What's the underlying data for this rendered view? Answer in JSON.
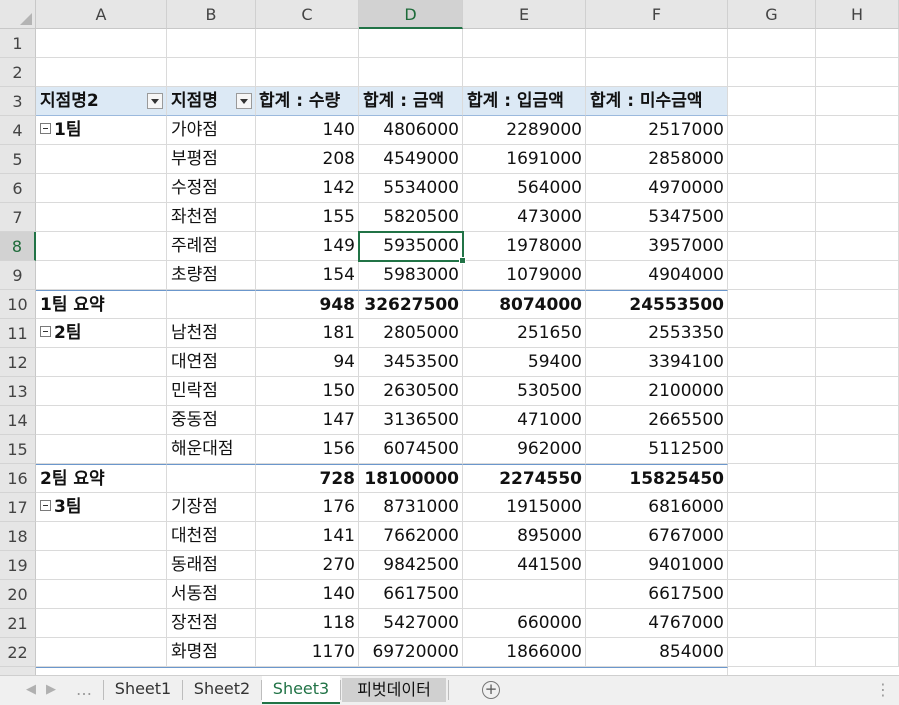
{
  "columns": [
    "A",
    "B",
    "C",
    "D",
    "E",
    "F",
    "G",
    "H"
  ],
  "rows": [
    "1",
    "2",
    "3",
    "4",
    "5",
    "6",
    "7",
    "8",
    "9",
    "10",
    "11",
    "12",
    "13",
    "14",
    "15",
    "16",
    "17",
    "18",
    "19",
    "20",
    "21",
    "22"
  ],
  "headers": {
    "a": "지점명2",
    "b": "지점명",
    "c": "합계 : 수량",
    "d": "합계 : 금액",
    "e": "합계 : 입금액",
    "f": "합계 : 미수금액"
  },
  "groups": {
    "g1": "1팀",
    "g2": "2팀",
    "g3": "3팀"
  },
  "data_rows": [
    {
      "a": "1팀",
      "b": "가야점",
      "c": "140",
      "d": "4806000",
      "e": "2289000",
      "f": "2517000"
    },
    {
      "a": "",
      "b": "부평점",
      "c": "208",
      "d": "4549000",
      "e": "1691000",
      "f": "2858000"
    },
    {
      "a": "",
      "b": "수정점",
      "c": "142",
      "d": "5534000",
      "e": "564000",
      "f": "4970000"
    },
    {
      "a": "",
      "b": "좌천점",
      "c": "155",
      "d": "5820500",
      "e": "473000",
      "f": "5347500"
    },
    {
      "a": "",
      "b": "주례점",
      "c": "149",
      "d": "5935000",
      "e": "1978000",
      "f": "3957000"
    },
    {
      "a": "",
      "b": "초량점",
      "c": "154",
      "d": "5983000",
      "e": "1079000",
      "f": "4904000"
    },
    {
      "a": "1팀 요약",
      "b": "",
      "c": "948",
      "d": "32627500",
      "e": "8074000",
      "f": "24553500"
    },
    {
      "a": "2팀",
      "b": "남천점",
      "c": "181",
      "d": "2805000",
      "e": "251650",
      "f": "2553350"
    },
    {
      "a": "",
      "b": "대연점",
      "c": "94",
      "d": "3453500",
      "e": "59400",
      "f": "3394100"
    },
    {
      "a": "",
      "b": "민락점",
      "c": "150",
      "d": "2630500",
      "e": "530500",
      "f": "2100000"
    },
    {
      "a": "",
      "b": "중동점",
      "c": "147",
      "d": "3136500",
      "e": "471000",
      "f": "2665500"
    },
    {
      "a": "",
      "b": "해운대점",
      "c": "156",
      "d": "6074500",
      "e": "962000",
      "f": "5112500"
    },
    {
      "a": "2팀 요약",
      "b": "",
      "c": "728",
      "d": "18100000",
      "e": "2274550",
      "f": "15825450"
    },
    {
      "a": "3팀",
      "b": "기장점",
      "c": "176",
      "d": "8731000",
      "e": "1915000",
      "f": "6816000"
    },
    {
      "a": "",
      "b": "대천점",
      "c": "141",
      "d": "7662000",
      "e": "895000",
      "f": "6767000"
    },
    {
      "a": "",
      "b": "동래점",
      "c": "270",
      "d": "9842500",
      "e": "441500",
      "f": "9401000"
    },
    {
      "a": "",
      "b": "서동점",
      "c": "140",
      "d": "6617500",
      "e": "",
      "f": "6617500"
    },
    {
      "a": "",
      "b": "장전점",
      "c": "118",
      "d": "5427000",
      "e": "660000",
      "f": "4767000"
    },
    {
      "a": "",
      "b": "화명점",
      "c": "1170",
      "d": "69720000",
      "e": "1866000",
      "f": "854000"
    }
  ],
  "selected_cell": "D8",
  "tabs": [
    "Sheet1",
    "Sheet2",
    "Sheet3",
    "피벗데이터"
  ],
  "active_tab": "Sheet3",
  "colors": {
    "accent": "#217346",
    "pivot_header": "#dce9f5",
    "subtotal_border": "#6b97cc"
  }
}
